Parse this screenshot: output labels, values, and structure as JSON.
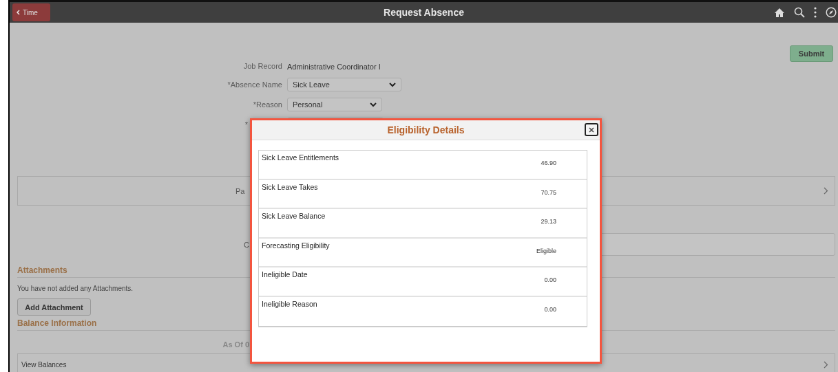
{
  "header": {
    "back_label": "Time",
    "title": "Request Absence"
  },
  "submit": "Submit",
  "form": [
    {
      "label": "Job Record",
      "value": "Administrative Coordinator I",
      "kind": "text"
    },
    {
      "label": "*Absence Name",
      "value": "Sick Leave",
      "kind": "select"
    },
    {
      "label": "*Reason",
      "value": "Personal",
      "kind": "select"
    },
    {
      "label": "*",
      "kind": "select"
    }
  ],
  "partial_days": {
    "label": "Pa"
  },
  "comments": {
    "label": "C"
  },
  "attachments": {
    "heading": "Attachments",
    "message": "You have not added any Attachments.",
    "button": "Add Attachment"
  },
  "balance": {
    "heading": "Balance Information",
    "as_of": "As Of 0",
    "view_balances": "View Balances"
  },
  "modal": {
    "title": "Eligibility Details",
    "rows": [
      {
        "label": "Sick Leave Entitlements",
        "value": "46.90"
      },
      {
        "label": "Sick Leave Takes",
        "value": "70.75"
      },
      {
        "label": "Sick Leave Balance",
        "value": "29.13"
      },
      {
        "label": "Forecasting Eligibility",
        "value": "Eligible"
      },
      {
        "label": "Ineligible Date",
        "value": "0.00"
      },
      {
        "label": "Ineligible Reason",
        "value": "0.00"
      }
    ]
  }
}
